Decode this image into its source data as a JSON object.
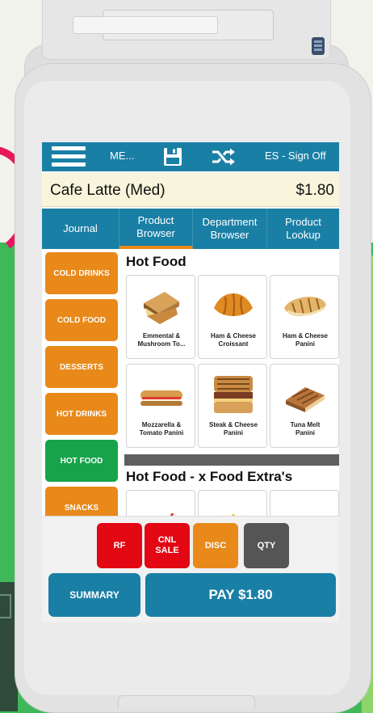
{
  "topbar": {
    "menu_label": "ME...",
    "signoff_label": "ES - Sign Off"
  },
  "current_item": {
    "name": "Cafe Latte (Med)",
    "price": "$1.80"
  },
  "tabs": [
    {
      "label": "Journal",
      "active": false
    },
    {
      "label": "Product\nBrowser",
      "active": true
    },
    {
      "label": "Department\nBrowser",
      "active": false
    },
    {
      "label": "Product\nLookup",
      "active": false
    }
  ],
  "categories": [
    {
      "label": "COLD DRINKS",
      "color": "#e8891a"
    },
    {
      "label": "COLD FOOD",
      "color": "#e8891a"
    },
    {
      "label": "DESSERTS",
      "color": "#e8891a"
    },
    {
      "label": "HOT DRINKS",
      "color": "#e8891a"
    },
    {
      "label": "HOT FOOD",
      "color": "#16a34a",
      "selected": true
    },
    {
      "label": "SNACKS",
      "color": "#e8891a"
    }
  ],
  "sections": [
    {
      "title": "Hot Food",
      "products": [
        {
          "label": "Emmental &\nMushroom To...",
          "icon": "toastie-icon"
        },
        {
          "label": "Ham & Cheese\nCroissant",
          "icon": "croissant-icon"
        },
        {
          "label": "Ham & Cheese\nPanini",
          "icon": "panini-icon"
        },
        {
          "label": "Mozzarella &\nTomato Panini",
          "icon": "baguette-icon"
        },
        {
          "label": "Steak & Cheese\nPanini",
          "icon": "steak-panini-icon"
        },
        {
          "label": "Tuna Melt\nPanini",
          "icon": "tuna-panini-icon"
        }
      ]
    },
    {
      "title": "Hot Food - x Food Extra's"
    }
  ],
  "actions": {
    "rf": "RF",
    "cnl_sale": "CNL\nSALE",
    "disc": "DISC",
    "qty": "QTY",
    "summary": "SUMMARY",
    "pay": "PAY $1.80"
  },
  "colors": {
    "primary": "#1a7fa5",
    "orange": "#e8891a",
    "green": "#16a34a",
    "red": "#e30613",
    "gray": "#555555",
    "item_bar": "#f9f5dc"
  }
}
